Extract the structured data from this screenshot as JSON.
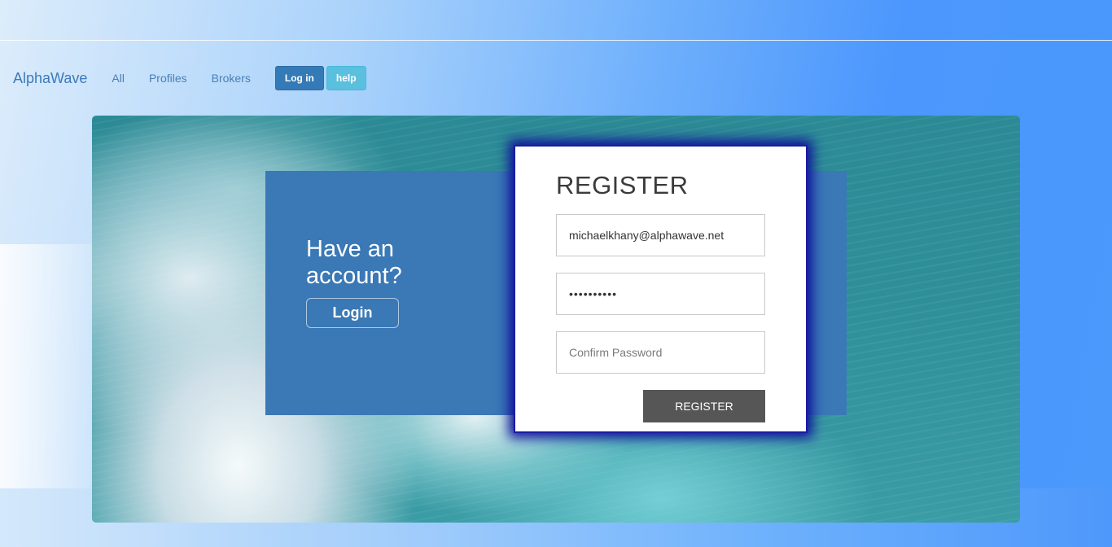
{
  "nav": {
    "brand": "AlphaWave",
    "links": [
      "All",
      "Profiles",
      "Brokers"
    ],
    "login_button": "Log in",
    "help_button": "help"
  },
  "login_panel": {
    "heading": "Have an account?",
    "button": "Login"
  },
  "register": {
    "title": "REGISTER",
    "email_value": "michaelkhany@alphawave.net",
    "password_value": "••••••••••",
    "confirm_placeholder": "Confirm Password",
    "submit_label": "REGISTER"
  },
  "colors": {
    "brand_blue": "#3a78b6",
    "login_btn": "#337ab7",
    "help_btn": "#5bc0de",
    "register_btn": "#565656",
    "card_glow": "#10109a"
  }
}
